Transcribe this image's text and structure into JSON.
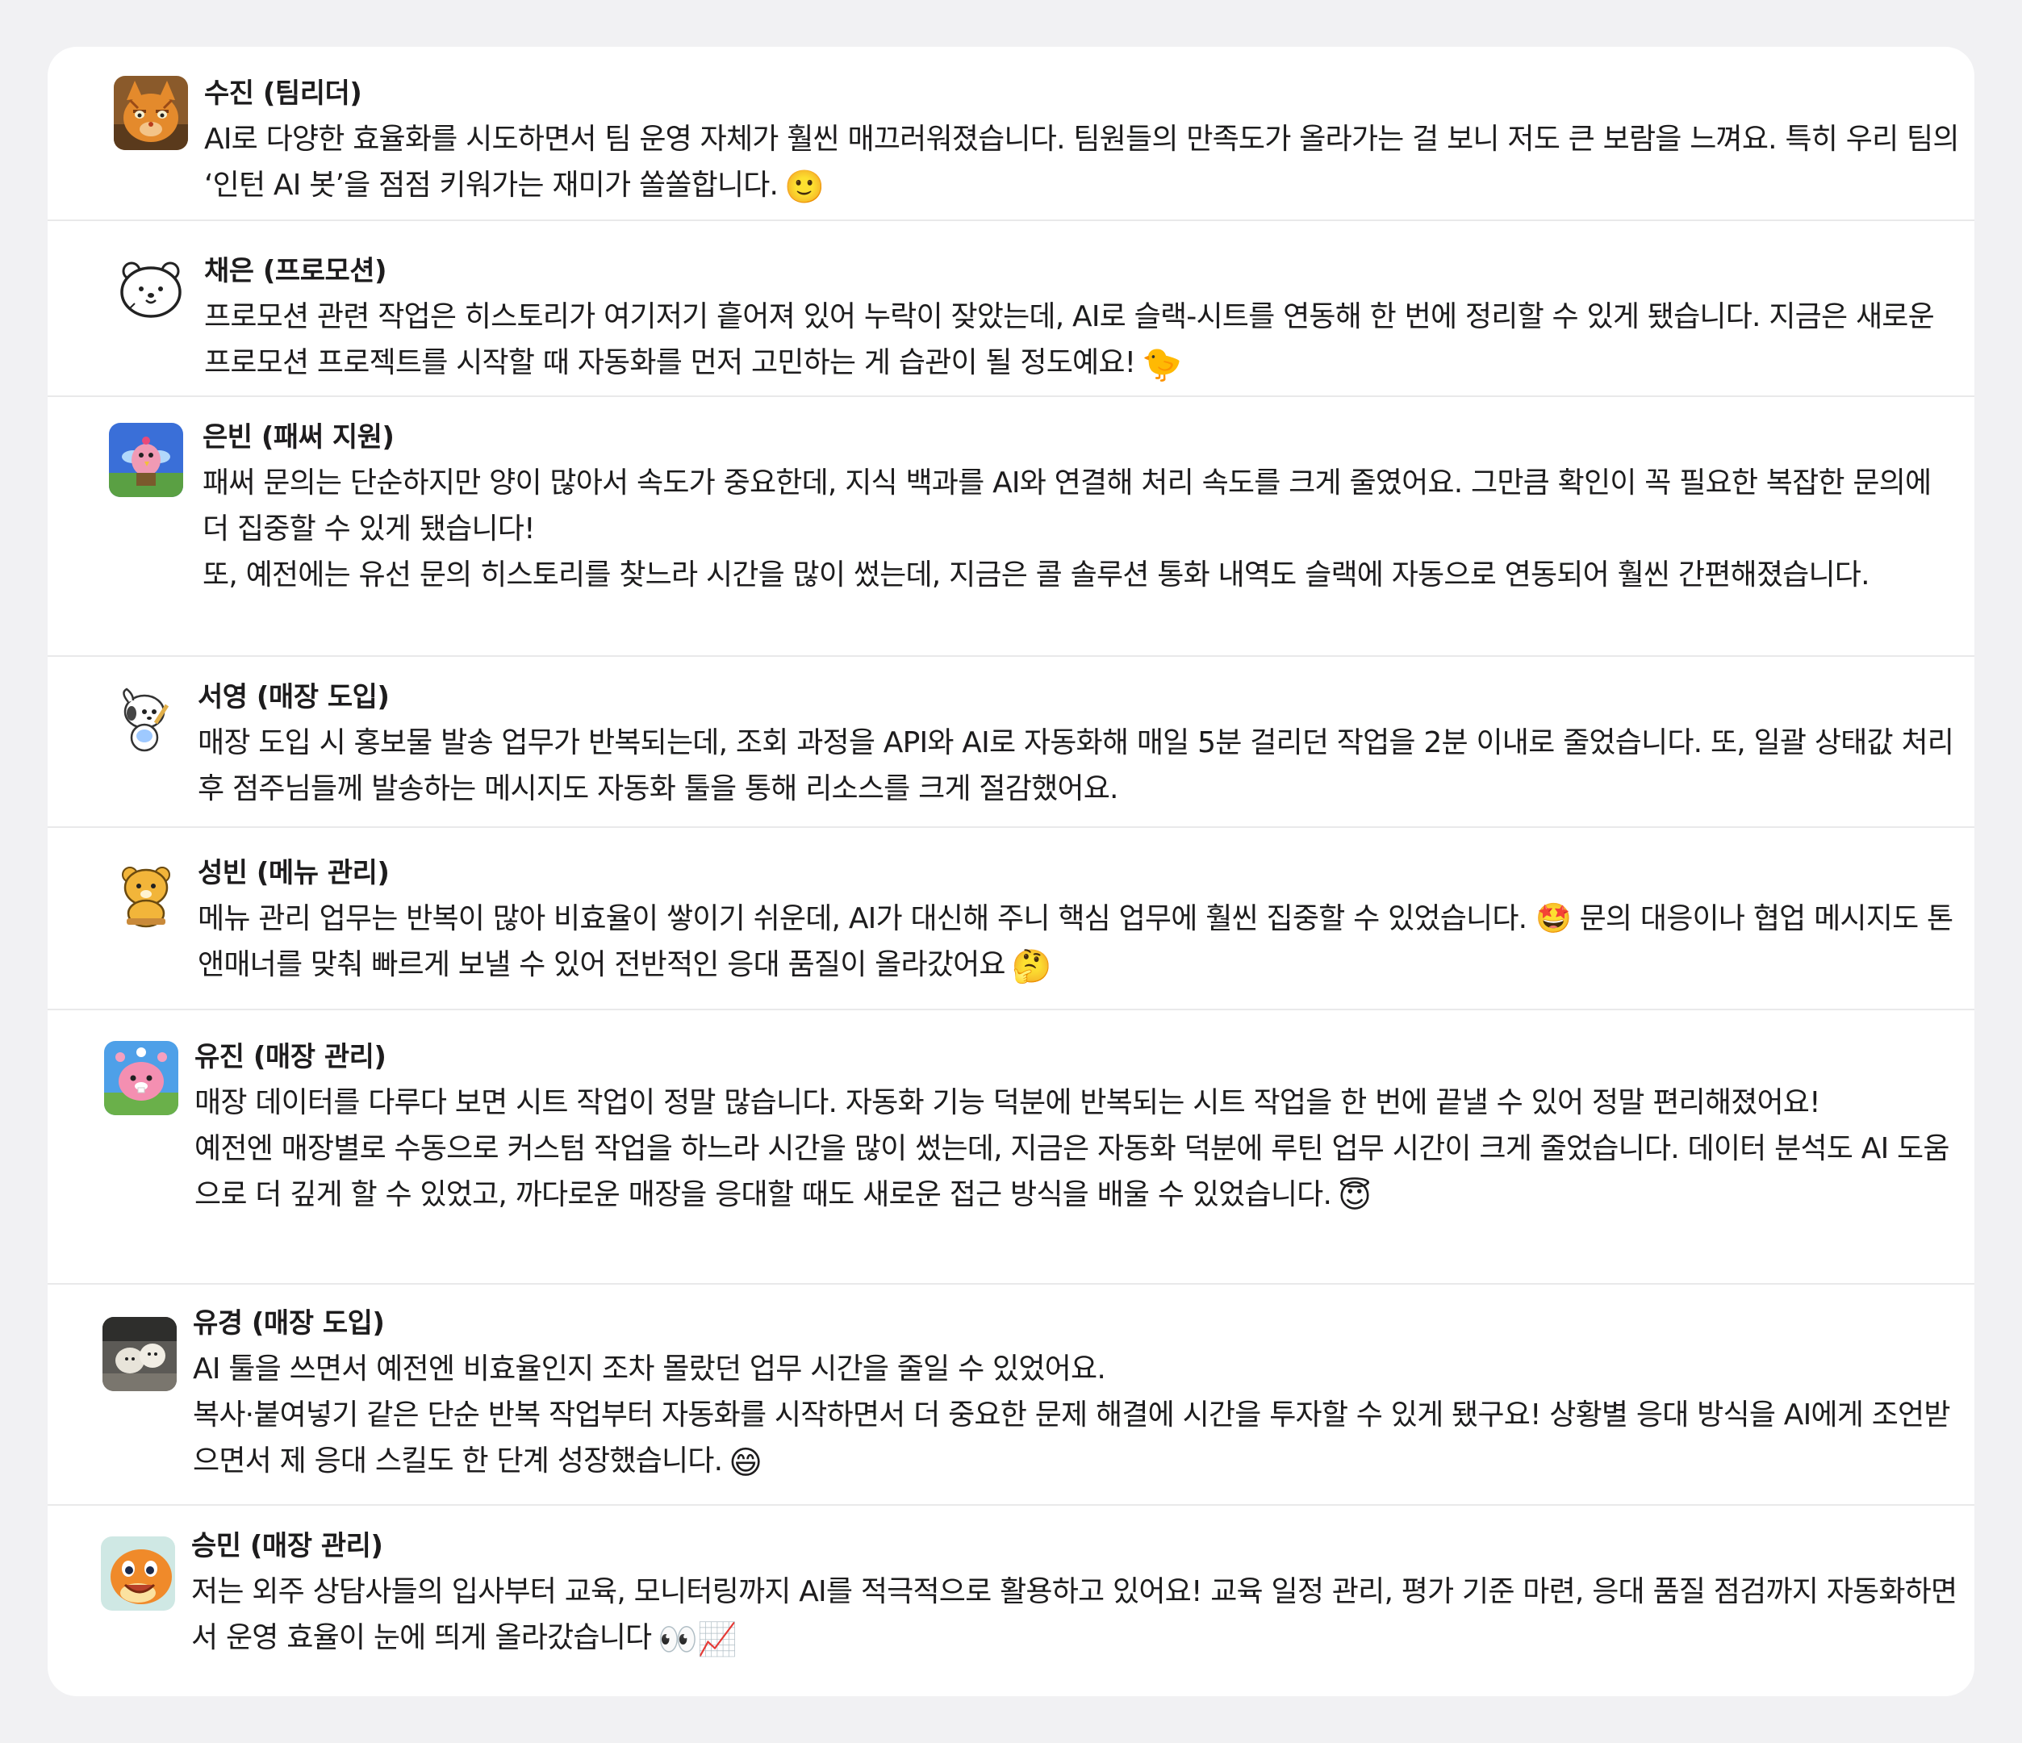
{
  "messages": [
    {
      "name": "수진 (팀리더)",
      "avatar": "orange-cat-avatar",
      "paragraphs": [
        "AI로 다양한 효율화를 시도하면서 팀 운영 자체가 훨씬 매끄러워졌습니다. 팀원들의 만족도가 올라가는 걸 보니 저도 큰 보람을 느껴요. 특히 우리 팀의 ‘인턴 AI 봇’을 점점 키워가는 재미가 쏠쏠합니다."
      ],
      "emoji": "🙂"
    },
    {
      "name": "채은 (프로모션)",
      "avatar": "bear-face-avatar",
      "paragraphs": [
        "프로모션 관련 작업은 히스토리가 여기저기 흩어져 있어 누락이 잦았는데, AI로 슬랙-시트를 연동해 한 번에 정리할 수 있게 됐습니다. 지금은 새로운 프로모션 프로젝트를 시작할 때 자동화를 먼저 고민하는 게 습관이 될 정도예요!"
      ],
      "emoji": "🐤"
    },
    {
      "name": "은빈 (패써 지원)",
      "avatar": "pink-bird-avatar",
      "paragraphs": [
        "패써 문의는 단순하지만 양이 많아서 속도가 중요한데, 지식 백과를 AI와 연결해 처리 속도를 크게 줄였어요. 그만큼 확인이 꼭 필요한 복잡한 문의에 더 집중할 수 있게 됐습니다!",
        "또, 예전에는 유선 문의 히스토리를 찾느라 시간을 많이 썼는데, 지금은 콜 솔루션 통화 내역도 슬랙에 자동으로 연동되어 훨씬 간편해졌습니다."
      ],
      "emoji": ""
    },
    {
      "name": "서영 (매장 도입)",
      "avatar": "white-puppy-avatar",
      "paragraphs": [
        "매장 도입 시 홍보물 발송 업무가 반복되는데, 조회 과정을 API와 AI로 자동화해 매일 5분 걸리던 작업을 2분 이내로 줄었습니다. 또, 일괄 상태값 처리 후 점주님들께 발송하는 메시지도 자동화 툴을 통해 리소스를 크게 절감했어요."
      ],
      "emoji": ""
    },
    {
      "name": "성빈 (메뉴 관리)",
      "avatar": "yellow-bear-avatar",
      "paragraphs": [
        "메뉴 관리 업무는 반복이 많아 비효율이 쌓이기 쉬운데, AI가 대신해 주니 핵심 업무에 훨씬 집중할 수 있었습니다. 🤩 문의 대응이나 협업 메시지도 톤앤매너를 맞춰 빠르게 보낼 수 있어 전반적인 응대 품질이 올라갔어요"
      ],
      "emoji": "🤔"
    },
    {
      "name": "유진 (매장 관리)",
      "avatar": "pink-beaver-avatar",
      "paragraphs": [
        "매장 데이터를 다루다 보면 시트 작업이 정말 많습니다. 자동화 기능 덕분에 반복되는 시트 작업을 한 번에 끝낼 수 있어 정말 편리해졌어요!",
        "예전엔 매장별로 수동으로 커스텀 작업을 하느라 시간을 많이 썼는데, 지금은 자동화 덕분에 루틴 업무 시간이 크게 줄었습니다. 데이터 분석도 AI 도움으로 더 깊게 할 수 있었고, 까다로운 매장을 응대할 때도 새로운 접근 방식을 배울 수 있었습니다."
      ],
      "emoji": "😇"
    },
    {
      "name": "유경 (매장 도입)",
      "avatar": "white-dogs-photo-avatar",
      "paragraphs": [
        "AI 툴을 쓰면서 예전엔 비효율인지 조차 몰랐던 업무 시간을 줄일 수 있었어요.",
        "복사·붙여넣기 같은 단순 반복 작업부터 자동화를 시작하면서 더 중요한 문제 해결에 시간을 투자할 수 있게 됐구요! 상황별 응대 방식을 AI에게 조언받으면서 제 응대 스킬도 한 단계 성장했습니다."
      ],
      "emoji": "😄"
    },
    {
      "name": "승민 (매장 관리)",
      "avatar": "orange-lizard-avatar",
      "paragraphs": [
        "저는 외주 상담사들의 입사부터 교육, 모니터링까지 AI를 적극적으로 활용하고 있어요! 교육 일정 관리, 평가 기준 마련, 응대 품질 점검까지 자동화하면서 운영 효율이 눈에 띄게 올라갔습니다"
      ],
      "emoji": "👀📈"
    }
  ]
}
